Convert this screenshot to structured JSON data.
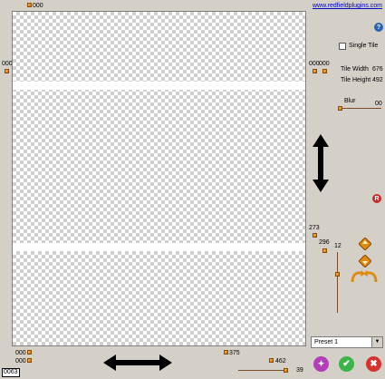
{
  "header": {
    "link_text": "www.redfieldplugins.com"
  },
  "top_handle": {
    "value": "000"
  },
  "left_handle": {
    "value": "000"
  },
  "right_handles": {
    "left_value": "000",
    "right_value": "000"
  },
  "bottom_left": {
    "top_value": "000",
    "bottom_value": "000"
  },
  "bottom_mid": {
    "value": "375"
  },
  "bottom_right": {
    "value": "462"
  },
  "right_mid": {
    "value_a": "273",
    "value_b": "296"
  },
  "options": {
    "single_tile_label": "Single Tile",
    "single_tile_checked": false,
    "tile_width_label": "Tile Width",
    "tile_width_value": "676",
    "tile_height_label": "Tile Height",
    "tile_height_value": "492",
    "blur_label": "Blur",
    "blur_value": "00"
  },
  "vertical_slider": {
    "value": "12"
  },
  "bottom_slider": {
    "value": "39"
  },
  "preset": {
    "selected": "Preset 1"
  },
  "status": {
    "counter": "0063"
  },
  "colors": {
    "accent": "#e08a10",
    "ok": "#3bb54a",
    "cancel": "#d9322c",
    "help": "#2b63b8",
    "reset": "#cc2a2a",
    "magic": "#b23fb8"
  }
}
